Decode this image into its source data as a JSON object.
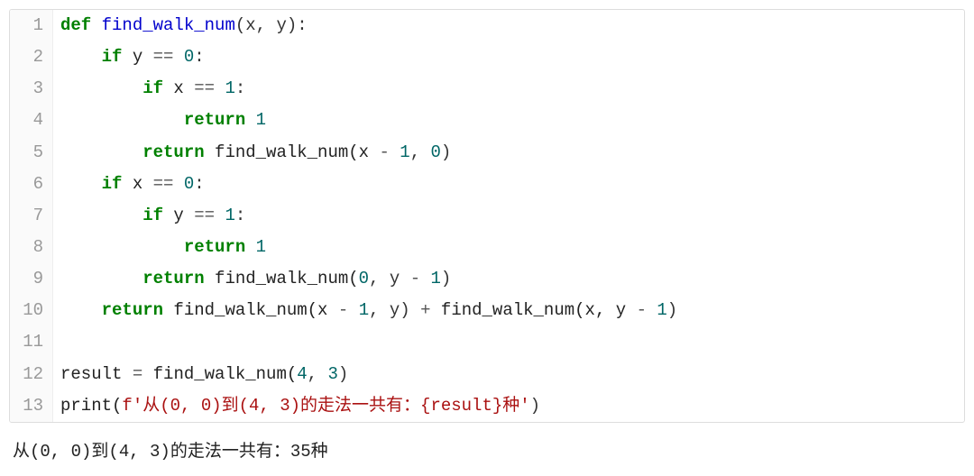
{
  "code": {
    "lines": [
      {
        "n": "1",
        "tokens": [
          {
            "c": "kw",
            "t": "def"
          },
          {
            "c": "nm",
            "t": " "
          },
          {
            "c": "fn",
            "t": "find_walk_num"
          },
          {
            "c": "pn",
            "t": "(x, y):"
          }
        ]
      },
      {
        "n": "2",
        "tokens": [
          {
            "c": "nm",
            "t": "    "
          },
          {
            "c": "kw",
            "t": "if"
          },
          {
            "c": "nm",
            "t": " y "
          },
          {
            "c": "op",
            "t": "=="
          },
          {
            "c": "nm",
            "t": " "
          },
          {
            "c": "num",
            "t": "0"
          },
          {
            "c": "pn",
            "t": ":"
          }
        ]
      },
      {
        "n": "3",
        "tokens": [
          {
            "c": "nm",
            "t": "        "
          },
          {
            "c": "kw",
            "t": "if"
          },
          {
            "c": "nm",
            "t": " x "
          },
          {
            "c": "op",
            "t": "=="
          },
          {
            "c": "nm",
            "t": " "
          },
          {
            "c": "num",
            "t": "1"
          },
          {
            "c": "pn",
            "t": ":"
          }
        ]
      },
      {
        "n": "4",
        "tokens": [
          {
            "c": "nm",
            "t": "            "
          },
          {
            "c": "kw",
            "t": "return"
          },
          {
            "c": "nm",
            "t": " "
          },
          {
            "c": "num",
            "t": "1"
          }
        ]
      },
      {
        "n": "5",
        "tokens": [
          {
            "c": "nm",
            "t": "        "
          },
          {
            "c": "kw",
            "t": "return"
          },
          {
            "c": "nm",
            "t": " find_walk_num(x "
          },
          {
            "c": "op",
            "t": "-"
          },
          {
            "c": "nm",
            "t": " "
          },
          {
            "c": "num",
            "t": "1"
          },
          {
            "c": "pn",
            "t": ", "
          },
          {
            "c": "num",
            "t": "0"
          },
          {
            "c": "pn",
            "t": ")"
          }
        ]
      },
      {
        "n": "6",
        "tokens": [
          {
            "c": "nm",
            "t": "    "
          },
          {
            "c": "kw",
            "t": "if"
          },
          {
            "c": "nm",
            "t": " x "
          },
          {
            "c": "op",
            "t": "=="
          },
          {
            "c": "nm",
            "t": " "
          },
          {
            "c": "num",
            "t": "0"
          },
          {
            "c": "pn",
            "t": ":"
          }
        ]
      },
      {
        "n": "7",
        "tokens": [
          {
            "c": "nm",
            "t": "        "
          },
          {
            "c": "kw",
            "t": "if"
          },
          {
            "c": "nm",
            "t": " y "
          },
          {
            "c": "op",
            "t": "=="
          },
          {
            "c": "nm",
            "t": " "
          },
          {
            "c": "num",
            "t": "1"
          },
          {
            "c": "pn",
            "t": ":"
          }
        ]
      },
      {
        "n": "8",
        "tokens": [
          {
            "c": "nm",
            "t": "            "
          },
          {
            "c": "kw",
            "t": "return"
          },
          {
            "c": "nm",
            "t": " "
          },
          {
            "c": "num",
            "t": "1"
          }
        ]
      },
      {
        "n": "9",
        "tokens": [
          {
            "c": "nm",
            "t": "        "
          },
          {
            "c": "kw",
            "t": "return"
          },
          {
            "c": "nm",
            "t": " find_walk_num("
          },
          {
            "c": "num",
            "t": "0"
          },
          {
            "c": "pn",
            "t": ", y "
          },
          {
            "c": "op",
            "t": "-"
          },
          {
            "c": "nm",
            "t": " "
          },
          {
            "c": "num",
            "t": "1"
          },
          {
            "c": "pn",
            "t": ")"
          }
        ]
      },
      {
        "n": "10",
        "tokens": [
          {
            "c": "nm",
            "t": "    "
          },
          {
            "c": "kw",
            "t": "return"
          },
          {
            "c": "nm",
            "t": " find_walk_num(x "
          },
          {
            "c": "op",
            "t": "-"
          },
          {
            "c": "nm",
            "t": " "
          },
          {
            "c": "num",
            "t": "1"
          },
          {
            "c": "pn",
            "t": ", y) "
          },
          {
            "c": "op",
            "t": "+"
          },
          {
            "c": "nm",
            "t": " find_walk_num(x, y "
          },
          {
            "c": "op",
            "t": "-"
          },
          {
            "c": "nm",
            "t": " "
          },
          {
            "c": "num",
            "t": "1"
          },
          {
            "c": "pn",
            "t": ")"
          }
        ]
      },
      {
        "n": "11",
        "tokens": [
          {
            "c": "nm",
            "t": ""
          }
        ]
      },
      {
        "n": "12",
        "tokens": [
          {
            "c": "nm",
            "t": "result "
          },
          {
            "c": "op",
            "t": "="
          },
          {
            "c": "nm",
            "t": " find_walk_num("
          },
          {
            "c": "num",
            "t": "4"
          },
          {
            "c": "pn",
            "t": ", "
          },
          {
            "c": "num",
            "t": "3"
          },
          {
            "c": "pn",
            "t": ")"
          }
        ]
      },
      {
        "n": "13",
        "tokens": [
          {
            "c": "nm",
            "t": "print("
          },
          {
            "c": "str",
            "t": "f'从(0, 0)到(4, 3)的走法一共有：{result}种'"
          },
          {
            "c": "pn",
            "t": ")"
          }
        ]
      }
    ]
  },
  "output_text": "从(0, 0)到(4, 3)的走法一共有：35种"
}
